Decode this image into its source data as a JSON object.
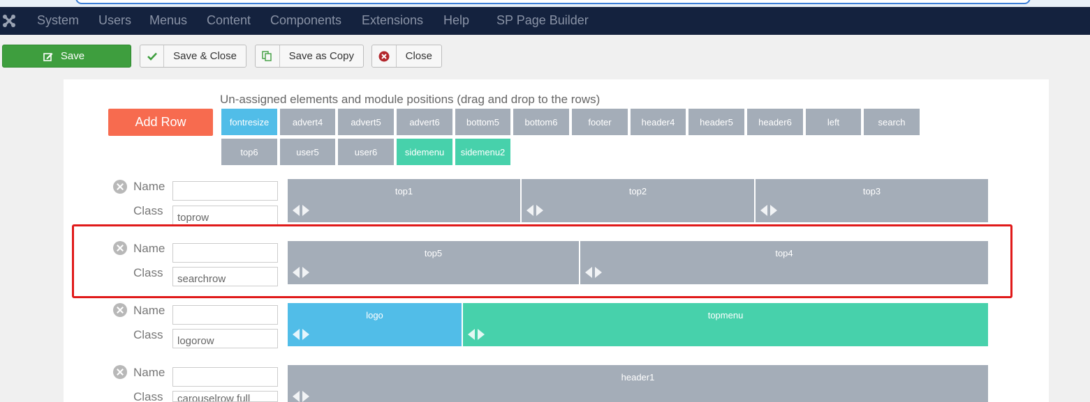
{
  "navbar": {
    "items": [
      "System",
      "Users",
      "Menus",
      "Content",
      "Components",
      "Extensions",
      "Help",
      "SP Page Builder"
    ]
  },
  "toolbar": {
    "save_label": "Save",
    "save_close_label": "Save & Close",
    "save_copy_label": "Save as Copy",
    "close_label": "Close"
  },
  "layout": {
    "unassigned_title": "Un-assigned elements and module positions (drag and drop to the rows)",
    "add_row_label": "Add Row",
    "unassigned": [
      {
        "label": "fontresize",
        "color": "blue"
      },
      {
        "label": "advert4",
        "color": "gray"
      },
      {
        "label": "advert5",
        "color": "gray"
      },
      {
        "label": "advert6",
        "color": "gray"
      },
      {
        "label": "bottom5",
        "color": "gray"
      },
      {
        "label": "bottom6",
        "color": "gray"
      },
      {
        "label": "footer",
        "color": "gray"
      },
      {
        "label": "header4",
        "color": "gray"
      },
      {
        "label": "header5",
        "color": "gray"
      },
      {
        "label": "header6",
        "color": "gray"
      },
      {
        "label": "left",
        "color": "gray"
      },
      {
        "label": "search",
        "color": "gray"
      },
      {
        "label": "top6",
        "color": "gray"
      },
      {
        "label": "user5",
        "color": "gray"
      },
      {
        "label": "user6",
        "color": "gray"
      },
      {
        "label": "sidemenu",
        "color": "green"
      },
      {
        "label": "sidemenu2",
        "color": "green"
      }
    ],
    "name_label": "Name",
    "class_label": "Class",
    "rows": [
      {
        "name": "",
        "class": "toprow",
        "columns": [
          {
            "label": "top1",
            "color": "gray"
          },
          {
            "label": "top2",
            "color": "gray"
          },
          {
            "label": "top3",
            "color": "gray"
          }
        ]
      },
      {
        "name": "",
        "class": "searchrow",
        "columns": [
          {
            "label": "top5",
            "color": "gray"
          },
          {
            "label": "top4",
            "color": "gray"
          }
        ]
      },
      {
        "name": "",
        "class": "logorow",
        "columns": [
          {
            "label": "logo",
            "color": "blue"
          },
          {
            "label": "topmenu",
            "color": "green"
          }
        ]
      },
      {
        "name": "",
        "class": "carouselrow full",
        "columns": [
          {
            "label": "header1",
            "color": "gray"
          }
        ]
      }
    ]
  },
  "colors": {
    "navbar_bg": "#14223e",
    "save_green": "#3e9e3e",
    "add_row": "#f76b4f",
    "chip_gray": "#a4adb8",
    "chip_blue": "#51bde8",
    "chip_green": "#47d1ab",
    "highlight_red": "#e01a1a"
  }
}
